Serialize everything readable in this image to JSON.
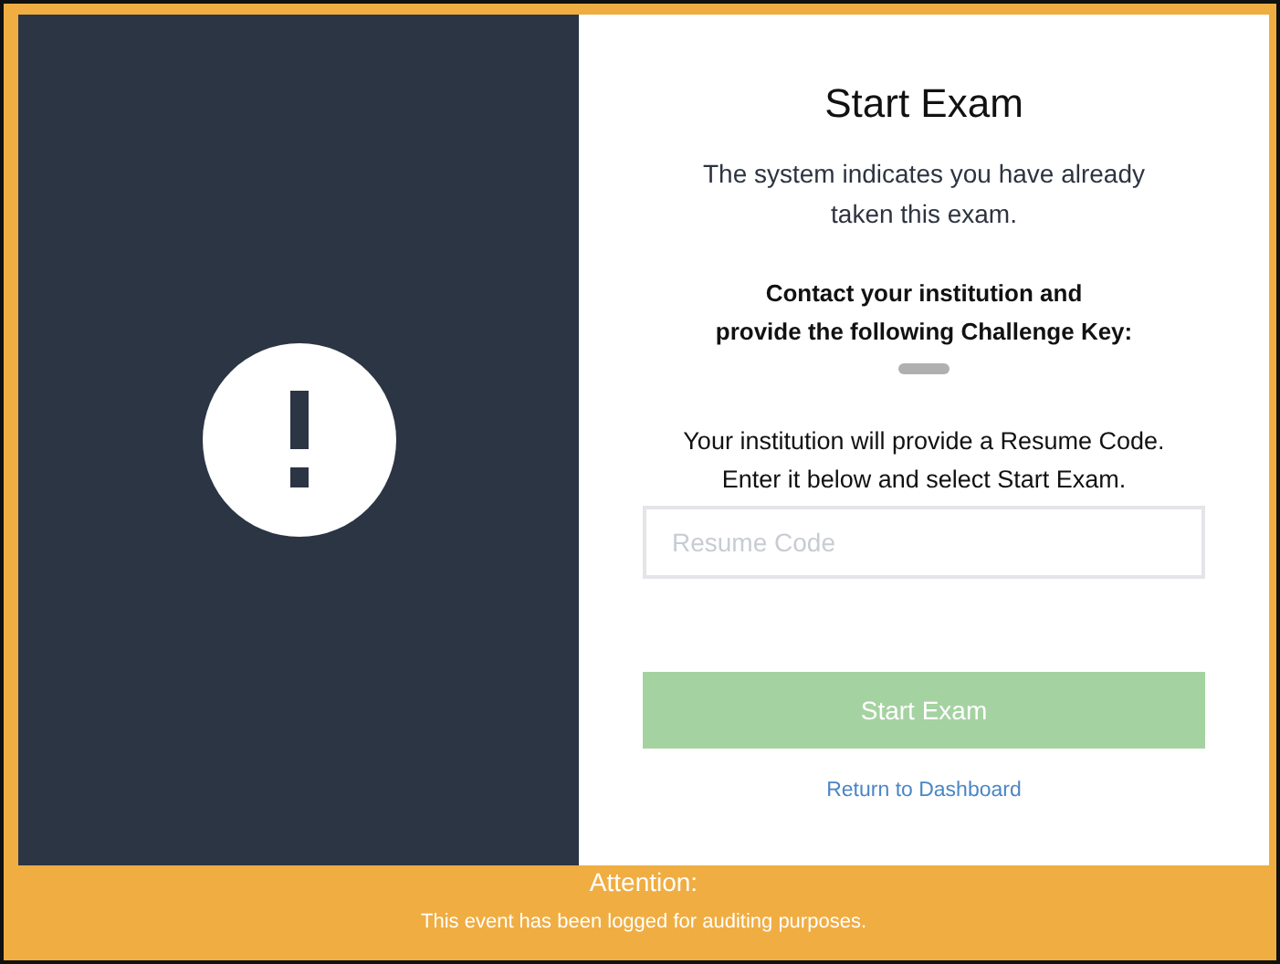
{
  "dialog": {
    "title": "Start Exam",
    "message": "The system indicates you have already taken this exam.",
    "instruction_lines": [
      "Contact your institution and",
      "provide the following Challenge Key:"
    ],
    "resume_info_lines": [
      "Your institution will provide a Resume Code.",
      "Enter it below and select Start Exam."
    ],
    "resume_field": {
      "placeholder": "Resume Code"
    },
    "start_button": {
      "label": "Start Exam",
      "disabled": true
    },
    "dashboard_link": "Return to Dashboard"
  },
  "footer": {
    "title": "Attention:",
    "message": "This event has been logged for auditing purposes."
  }
}
